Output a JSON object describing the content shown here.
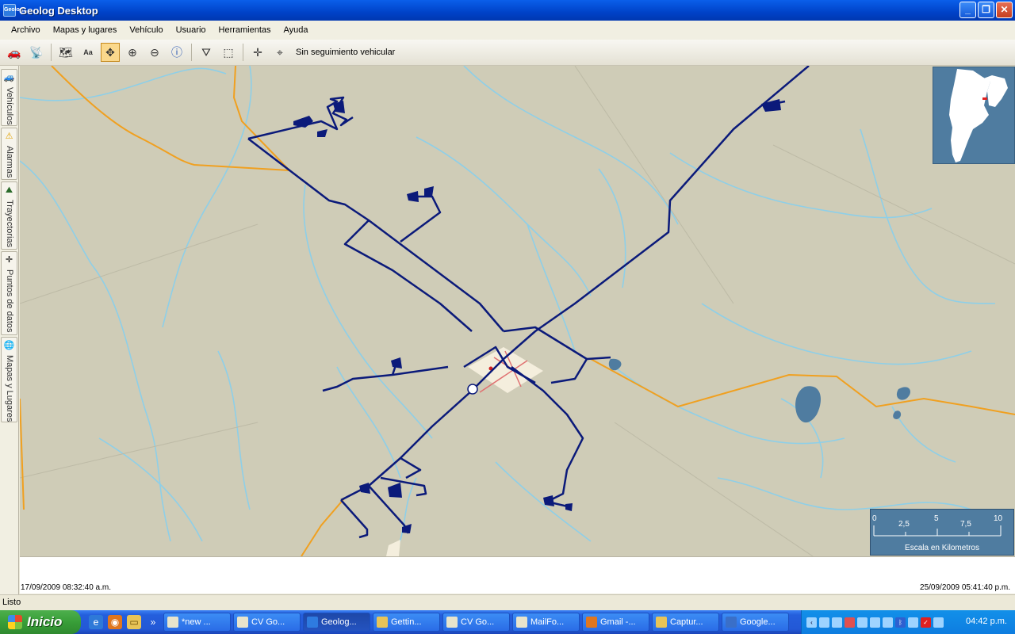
{
  "window": {
    "title": "Geolog Desktop",
    "app_icon": "Geolog"
  },
  "menu": [
    "Archivo",
    "Mapas y lugares",
    "Vehículo",
    "Usuario",
    "Herramientas",
    "Ayuda"
  ],
  "toolbar": {
    "tracking_label": "Sin seguimiento vehicular",
    "active_tool": "pan"
  },
  "sidebar": {
    "tabs": [
      {
        "label": "Vehículos",
        "icon": "car-icon"
      },
      {
        "label": "Alarmas",
        "icon": "warning-icon"
      },
      {
        "label": "Trayectorias",
        "icon": "route-icon"
      },
      {
        "label": "Puntos de datos",
        "icon": "crosshair-icon"
      },
      {
        "label": "Mapas y Lugares",
        "icon": "globe-icon"
      }
    ]
  },
  "scale": {
    "labels": [
      "0",
      "2,5",
      "5",
      "7,5",
      "10"
    ],
    "caption": "Escala en Kilometros"
  },
  "timeline": {
    "start": "17/09/2009 08:32:40 a.m.",
    "end": "25/09/2009 05:41:40 p.m."
  },
  "status": "Listo",
  "taskbar": {
    "start_label": "Inicio",
    "tasks": [
      "*new ...",
      "CV Go...",
      "Geolog...",
      "Gettin...",
      "CV Go...",
      "MailFo...",
      "Gmail -...",
      "Captur...",
      "Google..."
    ],
    "active_task": 2,
    "clock": "04:42 p.m."
  },
  "colors": {
    "route": "#0B1A7A",
    "river": "#8ECFE8",
    "road": "#F0A020",
    "land": "#CFCCB7",
    "water": "#4F7CA0"
  }
}
